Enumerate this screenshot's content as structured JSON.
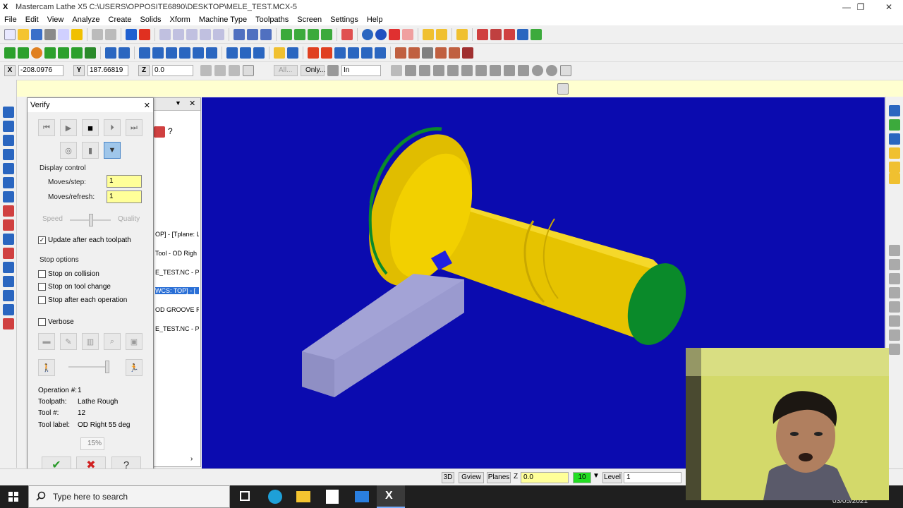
{
  "window": {
    "title": "Mastercam Lathe X5  C:\\USERS\\OPPOSITE6890\\DESKTOP\\MELE_TEST.MCX-5",
    "minimize": "—",
    "restore": "❐",
    "close": "✕"
  },
  "menu": [
    "File",
    "Edit",
    "View",
    "Analyze",
    "Create",
    "Solids",
    "Xform",
    "Machine Type",
    "Toolpaths",
    "Screen",
    "Settings",
    "Help"
  ],
  "coords": {
    "x_label": "X",
    "x_value": "-208.0976",
    "y_label": "Y",
    "y_value": "187.66819",
    "z_label": "Z",
    "z_value": "0.0",
    "all_button": "All...",
    "only_button": "Only...",
    "units_select": "In"
  },
  "manager": {
    "rows": [
      "OP] - [Tplane: L",
      "Tool - OD Righ",
      "E_TEST.NC - Pr",
      "WCS: TOP] - [",
      "OD GROOVE R",
      "E_TEST.NC - Pr"
    ]
  },
  "verify": {
    "title": "Verify",
    "close": "✕",
    "display_control_title": "Display control",
    "moves_step_label": "Moves/step:",
    "moves_step_value": "1",
    "moves_refresh_label": "Moves/refresh:",
    "moves_refresh_value": "1",
    "speed_label": "Speed",
    "quality_label": "Quality",
    "update_after_toolpath_label": "Update after each toolpath",
    "update_after_toolpath_checked": true,
    "stop_options_title": "Stop options",
    "stop_on_collision_label": "Stop on collision",
    "stop_on_tool_change_label": "Stop on tool change",
    "stop_after_operation_label": "Stop after each operation",
    "verbose_label": "Verbose",
    "operation_label": "Operation #:",
    "operation_value": "1",
    "toolpath_label": "Toolpath:",
    "toolpath_value": "Lathe Rough",
    "tool_num_label": "Tool #:",
    "tool_num_value": "12",
    "tool_label_label": "Tool label:",
    "tool_label_value": "OD Right 55 deg",
    "progress_text": "15%",
    "ok_symbol": "✔",
    "cancel_symbol": "✖",
    "help_symbol": "?"
  },
  "statusbar": {
    "mode_3d": "3D",
    "gview": "Gview",
    "planes": "Planes",
    "z_label": "Z",
    "z_value": "0.0",
    "color_value": "10",
    "level_label": "Level",
    "level_value": "1"
  },
  "taskbar": {
    "search_placeholder": "Type here to search",
    "date": "03/05/2021"
  },
  "colors": {
    "viewport_bg": "#0b0baf",
    "part_yellow": "#f2d000",
    "part_face_green": "#0a8a2a",
    "tool_gray": "#a3a3d6",
    "insert_blue": "#2020e0"
  }
}
